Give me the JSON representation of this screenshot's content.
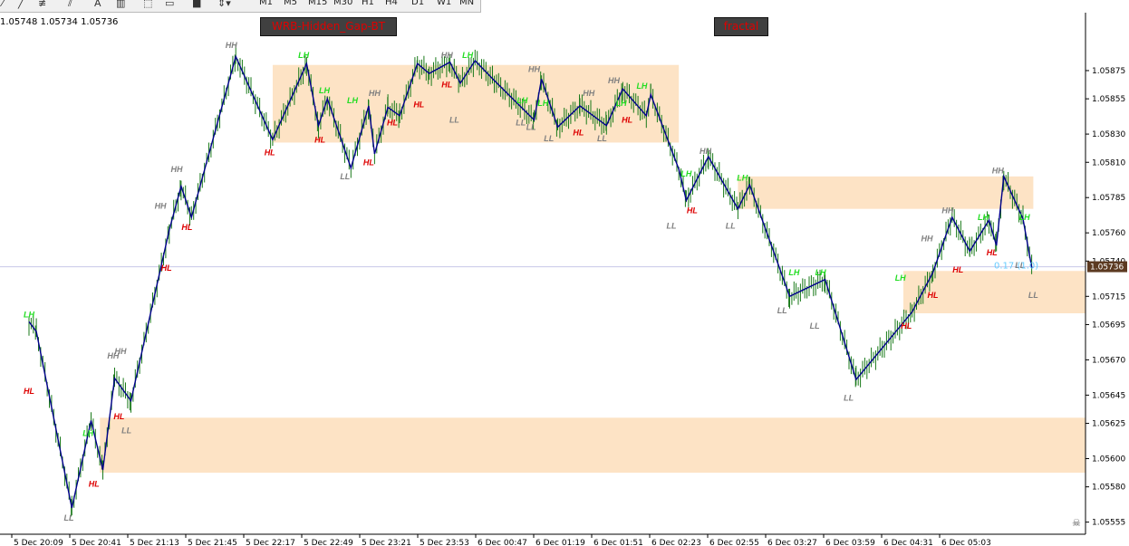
{
  "toolbar": {
    "tools": [
      "line-tool-icon",
      "fibonacci-tool-icon",
      "text-tool-icon",
      "channel-tool-icon",
      "rectangle-tool-icon",
      "arrows-tool-icon"
    ],
    "text_tool": "A",
    "timeframes": [
      "M1",
      "M5",
      "M15",
      "M30",
      "H1",
      "H4",
      "D1",
      "W1",
      "MN"
    ]
  },
  "ohlc_text": "1.05748 1.05734 1.05736",
  "buttons": {
    "indicator1": "WRB-Hidden_Gap-BT",
    "indicator2": "fractal"
  },
  "current_price": "1.05736",
  "signal_text": "0.17 (1.0)",
  "colors": {
    "zone": "#fde3c5",
    "zigzag": "#00008b",
    "candle": "#1a7a1a",
    "hh": "#808080",
    "ll": "#808080",
    "lh": "#22dd22",
    "hl": "#dd0000",
    "price_tag": "#5c3a21",
    "signal": "#66ccff"
  },
  "chart_data": {
    "type": "line",
    "ylim": [
      1.05545,
      1.05895
    ],
    "y_ticks": [
      "1.05875",
      "1.05855",
      "1.05830",
      "1.05810",
      "1.05785",
      "1.05760",
      "1.05740",
      "1.05715",
      "1.05695",
      "1.05670",
      "1.05645",
      "1.05625",
      "1.05600",
      "1.05580",
      "1.05555"
    ],
    "x_ticks": [
      "5 Dec 20:09",
      "5 Dec 20:41",
      "5 Dec 21:13",
      "5 Dec 21:45",
      "5 Dec 22:17",
      "5 Dec 22:49",
      "5 Dec 23:21",
      "5 Dec 23:53",
      "6 Dec 00:47",
      "6 Dec 01:19",
      "6 Dec 01:51",
      "6 Dec 02:23",
      "6 Dec 02:55",
      "6 Dec 03:27",
      "6 Dec 03:59",
      "6 Dec 04:31",
      "6 Dec 05:03"
    ],
    "x_range": [
      0,
      72
    ],
    "zones": [
      {
        "x1": 16.5,
        "x2": 44,
        "y1": 1.05879,
        "y2": 1.05824
      },
      {
        "x1": 48,
        "x2": 68,
        "y1": 1.058,
        "y2": 1.05777
      },
      {
        "x1": 59.2,
        "x2": 75,
        "y1": 1.05733,
        "y2": 1.05703
      },
      {
        "x1": 4.8,
        "x2": 75,
        "y1": 1.05629,
        "y2": 1.0559
      }
    ],
    "zigzag": [
      [
        0,
        1.05697
      ],
      [
        0.5,
        1.0569
      ],
      [
        2.9,
        1.05565
      ],
      [
        4.2,
        1.05627
      ],
      [
        5,
        1.05592
      ],
      [
        5.8,
        1.05657
      ],
      [
        6.9,
        1.05641
      ],
      [
        9.5,
        1.05762
      ],
      [
        10.3,
        1.05793
      ],
      [
        11,
        1.05771
      ],
      [
        14,
        1.05885
      ],
      [
        16.5,
        1.05826
      ],
      [
        18.8,
        1.0588
      ],
      [
        19.6,
        1.05836
      ],
      [
        20.2,
        1.05855
      ],
      [
        21.8,
        1.05806
      ],
      [
        23,
        1.0585
      ],
      [
        23.4,
        1.05816
      ],
      [
        24.3,
        1.05849
      ],
      [
        25.1,
        1.05843
      ],
      [
        26.3,
        1.0588
      ],
      [
        27.1,
        1.05873
      ],
      [
        28.5,
        1.05881
      ],
      [
        29.2,
        1.05866
      ],
      [
        30.2,
        1.05882
      ],
      [
        31.5,
        1.05868
      ],
      [
        34.2,
        1.0584
      ],
      [
        34.7,
        1.05869
      ],
      [
        35.8,
        1.05835
      ],
      [
        37.3,
        1.0585
      ],
      [
        39.1,
        1.05836
      ],
      [
        40.2,
        1.05862
      ],
      [
        41.8,
        1.05843
      ],
      [
        42.1,
        1.05858
      ],
      [
        44,
        1.05805
      ],
      [
        44.5,
        1.05783
      ],
      [
        46,
        1.05814
      ],
      [
        48,
        1.05777
      ],
      [
        48.8,
        1.05794
      ],
      [
        51.5,
        1.05715
      ],
      [
        53.9,
        1.05727
      ],
      [
        56,
        1.05656
      ],
      [
        59.8,
        1.05704
      ],
      [
        61.2,
        1.05732
      ],
      [
        62.5,
        1.05771
      ],
      [
        63.7,
        1.05747
      ],
      [
        65,
        1.05769
      ],
      [
        65.5,
        1.05751
      ],
      [
        66,
        1.058
      ],
      [
        67.3,
        1.0577
      ],
      [
        67.9,
        1.05735
      ]
    ],
    "annotations": [
      {
        "t": "HH",
        "x": 13.7,
        "y": 1.05891,
        "k": "hh"
      },
      {
        "t": "LH",
        "x": 18.6,
        "y": 1.05884,
        "k": "lh"
      },
      {
        "t": "LH",
        "x": 20,
        "y": 1.05859,
        "k": "lh"
      },
      {
        "t": "LH",
        "x": 21.9,
        "y": 1.05852,
        "k": "lh"
      },
      {
        "t": "HH",
        "x": 23.4,
        "y": 1.05857,
        "k": "hh"
      },
      {
        "t": "HH",
        "x": 28.3,
        "y": 1.05884,
        "k": "hh"
      },
      {
        "t": "LH",
        "x": 29.7,
        "y": 1.05884,
        "k": "lh"
      },
      {
        "t": "HH",
        "x": 34.2,
        "y": 1.05874,
        "k": "hh"
      },
      {
        "t": "LH",
        "x": 33.4,
        "y": 1.05852,
        "k": "lh"
      },
      {
        "t": "LH",
        "x": 34.8,
        "y": 1.0585,
        "k": "lh"
      },
      {
        "t": "HH",
        "x": 37.9,
        "y": 1.05857,
        "k": "hh"
      },
      {
        "t": "HH",
        "x": 39.6,
        "y": 1.05866,
        "k": "hh"
      },
      {
        "t": "LH",
        "x": 40.1,
        "y": 1.0585,
        "k": "lh"
      },
      {
        "t": "LH",
        "x": 41.5,
        "y": 1.05862,
        "k": "lh"
      },
      {
        "t": "HL",
        "x": 16.3,
        "y": 1.05815,
        "k": "hl"
      },
      {
        "t": "HL",
        "x": 19.7,
        "y": 1.05824,
        "k": "hl"
      },
      {
        "t": "LL",
        "x": 21.4,
        "y": 1.05798,
        "k": "ll"
      },
      {
        "t": "HL",
        "x": 23,
        "y": 1.05808,
        "k": "hl"
      },
      {
        "t": "HL",
        "x": 24.6,
        "y": 1.05836,
        "k": "hl"
      },
      {
        "t": "HL",
        "x": 26.4,
        "y": 1.05849,
        "k": "hl"
      },
      {
        "t": "HL",
        "x": 28.3,
        "y": 1.05863,
        "k": "hl"
      },
      {
        "t": "LL",
        "x": 28.8,
        "y": 1.05838,
        "k": "ll"
      },
      {
        "t": "LL",
        "x": 33.3,
        "y": 1.05836,
        "k": "ll"
      },
      {
        "t": "LL",
        "x": 34,
        "y": 1.05833,
        "k": "ll"
      },
      {
        "t": "LL",
        "x": 35.2,
        "y": 1.05825,
        "k": "ll"
      },
      {
        "t": "HL",
        "x": 37.2,
        "y": 1.05829,
        "k": "hl"
      },
      {
        "t": "LL",
        "x": 38.8,
        "y": 1.05825,
        "k": "ll"
      },
      {
        "t": "HL",
        "x": 40.5,
        "y": 1.05838,
        "k": "hl"
      },
      {
        "t": "HH",
        "x": 45.8,
        "y": 1.05816,
        "k": "hh"
      },
      {
        "t": "LH",
        "x": 44.5,
        "y": 1.058,
        "k": "lh"
      },
      {
        "t": "LH",
        "x": 48.3,
        "y": 1.05797,
        "k": "lh"
      },
      {
        "t": "HL",
        "x": 44.9,
        "y": 1.05774,
        "k": "hl"
      },
      {
        "t": "LL",
        "x": 43.5,
        "y": 1.05763,
        "k": "ll"
      },
      {
        "t": "LL",
        "x": 47.5,
        "y": 1.05763,
        "k": "ll"
      },
      {
        "t": "LH",
        "x": 51.8,
        "y": 1.0573,
        "k": "lh"
      },
      {
        "t": "LH",
        "x": 53.6,
        "y": 1.0573,
        "k": "lh"
      },
      {
        "t": "LL",
        "x": 51,
        "y": 1.05703,
        "k": "ll"
      },
      {
        "t": "LL",
        "x": 53.2,
        "y": 1.05692,
        "k": "ll"
      },
      {
        "t": "LL",
        "x": 55.5,
        "y": 1.05641,
        "k": "ll"
      },
      {
        "t": "LH",
        "x": 59,
        "y": 1.05726,
        "k": "lh"
      },
      {
        "t": "HL",
        "x": 59.4,
        "y": 1.05692,
        "k": "hl"
      },
      {
        "t": "HL",
        "x": 61.2,
        "y": 1.05714,
        "k": "hl"
      },
      {
        "t": "HH",
        "x": 60.8,
        "y": 1.05754,
        "k": "hh"
      },
      {
        "t": "HH",
        "x": 62.2,
        "y": 1.05774,
        "k": "hh"
      },
      {
        "t": "HL",
        "x": 62.9,
        "y": 1.05732,
        "k": "hl"
      },
      {
        "t": "HL",
        "x": 65.2,
        "y": 1.05744,
        "k": "hl"
      },
      {
        "t": "LH",
        "x": 64.6,
        "y": 1.05769,
        "k": "lh"
      },
      {
        "t": "HH",
        "x": 65.6,
        "y": 1.05802,
        "k": "hh"
      },
      {
        "t": "LH",
        "x": 67.4,
        "y": 1.05769,
        "k": "lh"
      },
      {
        "t": "LL",
        "x": 67.1,
        "y": 1.05735,
        "k": "ll"
      },
      {
        "t": "LL",
        "x": 68,
        "y": 1.05714,
        "k": "ll"
      },
      {
        "t": "LH",
        "x": 0,
        "y": 1.057,
        "k": "lh"
      },
      {
        "t": "HL",
        "x": 0,
        "y": 1.05646,
        "k": "hl"
      },
      {
        "t": "LH",
        "x": 4,
        "y": 1.05616,
        "k": "lh"
      },
      {
        "t": "HL",
        "x": 4.4,
        "y": 1.0558,
        "k": "hl"
      },
      {
        "t": "LL",
        "x": 2.7,
        "y": 1.05556,
        "k": "ll"
      },
      {
        "t": "HH",
        "x": 5.7,
        "y": 1.05671,
        "k": "hh"
      },
      {
        "t": "HH",
        "x": 6.2,
        "y": 1.05674,
        "k": "hh"
      },
      {
        "t": "HL",
        "x": 6.1,
        "y": 1.05628,
        "k": "hl"
      },
      {
        "t": "LL",
        "x": 6.6,
        "y": 1.05618,
        "k": "ll"
      },
      {
        "t": "HL",
        "x": 9.3,
        "y": 1.05733,
        "k": "hl"
      },
      {
        "t": "HH",
        "x": 8.9,
        "y": 1.05777,
        "k": "hh"
      },
      {
        "t": "HL",
        "x": 10.7,
        "y": 1.05762,
        "k": "hl"
      },
      {
        "t": "HH",
        "x": 10,
        "y": 1.05803,
        "k": "hh"
      }
    ]
  }
}
